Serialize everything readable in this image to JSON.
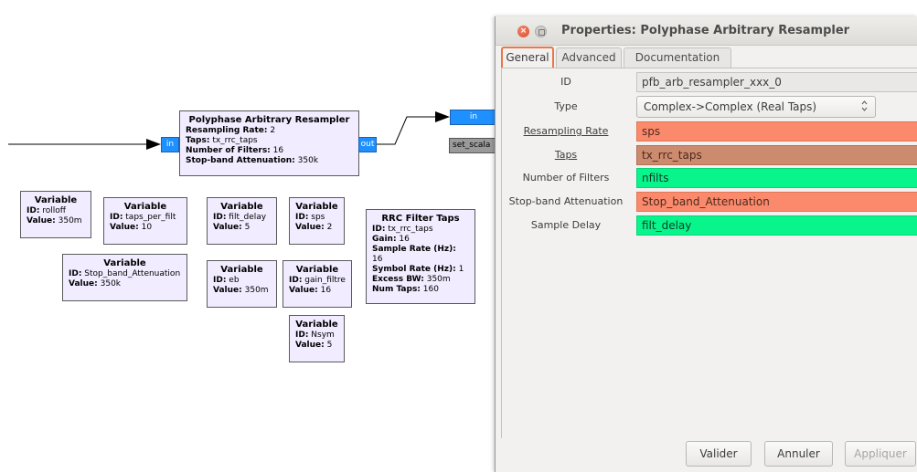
{
  "dialog": {
    "title": "Properties: Polyphase Arbitrary Resampler",
    "close_glyph": "×",
    "tabs": [
      "General",
      "Advanced",
      "Documentation"
    ],
    "active_tab": "General",
    "rows": {
      "id": {
        "label": "ID",
        "value": "pfb_arb_resampler_xxx_0"
      },
      "type": {
        "label": "Type",
        "value": "Complex->Complex (Real Taps)"
      },
      "resampling_rate": {
        "label": "Resampling Rate",
        "value": "sps"
      },
      "taps": {
        "label": "Taps",
        "value": "tx_rrc_taps"
      },
      "num_filters": {
        "label": "Number of Filters",
        "value": "nfilts"
      },
      "stopband": {
        "label": "Stop-band Attenuation",
        "value": "Stop_band_Attenuation"
      },
      "sample_delay": {
        "label": "Sample Delay",
        "value": "filt_delay"
      }
    },
    "buttons": {
      "ok": "Valider",
      "cancel": "Annuler",
      "apply": "Appliquer"
    },
    "colors": {
      "orange": "#fb8a6c",
      "brown": "#cc8a6e",
      "green": "#08f58c",
      "active_tab_border": "#e8784a"
    }
  },
  "flowgraph": {
    "resampler": {
      "title": "Polyphase Arbitrary Resampler",
      "l1k": "Resampling Rate:",
      "l1v": " 2",
      "l2k": "Taps:",
      "l2v": " tx_rrc_taps",
      "l3k": "Number of Filters:",
      "l3v": " 16",
      "l4k": "Stop-band Attenuation:",
      "l4v": " 350k",
      "port_in": "in",
      "port_out": "out"
    },
    "next_port_in": "in",
    "set_scalar_label": "set_scala",
    "variables": {
      "rolloff": {
        "title": "Variable",
        "idk": "ID:",
        "idv": " rolloff",
        "valk": "Value:",
        "valv": " 350m"
      },
      "taps_per_filt": {
        "title": "Variable",
        "idk": "ID:",
        "idv": " taps_per_filt",
        "valk": "Value:",
        "valv": " 10"
      },
      "filt_delay": {
        "title": "Variable",
        "idk": "ID:",
        "idv": " filt_delay",
        "valk": "Value:",
        "valv": " 5"
      },
      "sps": {
        "title": "Variable",
        "idk": "ID:",
        "idv": " sps",
        "valk": "Value:",
        "valv": " 2"
      },
      "stopband": {
        "title": "Variable",
        "idk": "ID:",
        "idv": " Stop_band_Attenuation",
        "valk": "Value:",
        "valv": " 350k"
      },
      "eb": {
        "title": "Variable",
        "idk": "ID:",
        "idv": " eb",
        "valk": "Value:",
        "valv": " 350m"
      },
      "gain_filtre": {
        "title": "Variable",
        "idk": "ID:",
        "idv": " gain_filtre",
        "valk": "Value:",
        "valv": " 16"
      },
      "nsym": {
        "title": "Variable",
        "idk": "ID:",
        "idv": " Nsym",
        "valk": "Value:",
        "valv": " 5"
      }
    },
    "rrc": {
      "title": "RRC Filter Taps",
      "idk": "ID:",
      "idv": " tx_rrc_taps",
      "gaink": "Gain:",
      "gainv": " 16",
      "srk": "Sample Rate (Hz):",
      "srv": " 16",
      "symk": "Symbol Rate (Hz):",
      "symv": " 1",
      "ebwk": "Excess BW:",
      "ebwv": " 350m",
      "ntk": "Num Taps:",
      "ntv": " 160"
    }
  }
}
